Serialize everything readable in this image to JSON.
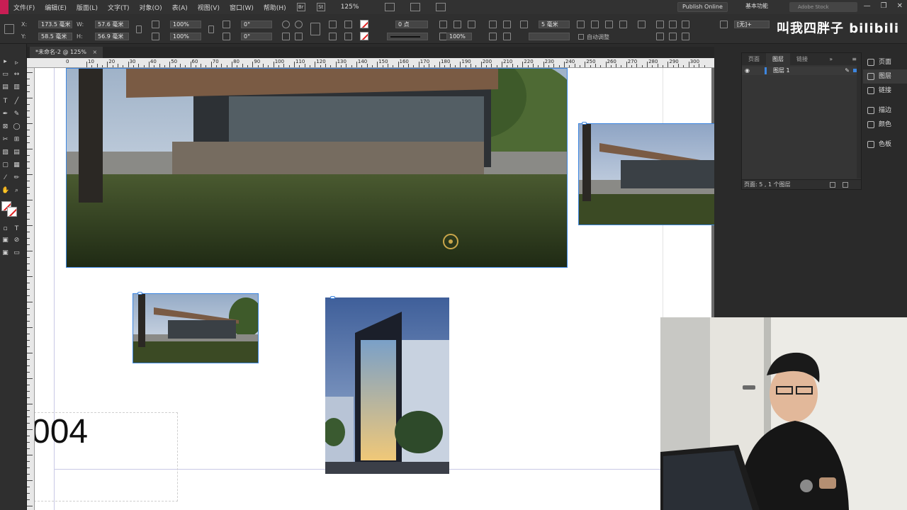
{
  "menu": {
    "items": [
      "文件(F)",
      "编辑(E)",
      "版面(L)",
      "文字(T)",
      "对象(O)",
      "表(A)",
      "视图(V)",
      "窗口(W)",
      "帮助(H)"
    ],
    "icon_br": "Br",
    "icon_st": "St",
    "zoom": "125%",
    "publish": "Publish Online",
    "workspace": "基本功能",
    "stock_placeholder": "Adobe Stock",
    "win_min": "—",
    "win_max": "❐",
    "win_close": "✕"
  },
  "control": {
    "x_label": "X:",
    "x": "173.5 毫米",
    "y_label": "Y:",
    "y": "58.5 毫米",
    "w_label": "W:",
    "w": "57.6 毫米",
    "h_label": "H:",
    "h": "56.9 毫米",
    "scale_x": "100%",
    "scale_y": "100%",
    "rotate": "0°",
    "shear": "0°",
    "stroke_weight": "0 点",
    "gap": "5 毫米",
    "opacity": "100%",
    "auto_fit": "自动调整",
    "style": "[无]+",
    "watermark": "叫我四胖子 bilibili"
  },
  "tab": {
    "title": "*未命名-2 @ 125%",
    "close": "×"
  },
  "ruler": {
    "labels": [
      "10",
      "20",
      "30",
      "40",
      "50",
      "60",
      "70",
      "80",
      "90",
      "100",
      "110",
      "120",
      "130",
      "140",
      "150",
      "160",
      "170",
      "180",
      "190",
      "200",
      "210",
      "220",
      "230",
      "240",
      "250",
      "260",
      "270",
      "280",
      "290",
      "300"
    ],
    "zero": "0"
  },
  "canvas": {
    "page_number": "004"
  },
  "panel": {
    "tabs": [
      "页面",
      "图层",
      "链接"
    ],
    "more": "»",
    "menu": "≡",
    "layer_name": "图层 1",
    "footer": "页面: 5 , 1 个图层",
    "side_tabs": [
      "页面",
      "图层",
      "链接",
      "描边",
      "颜色",
      "色板"
    ]
  },
  "colors": {
    "accent": "#3d86e0",
    "brand": "#c81e54",
    "panel_bg": "#2a2a2a",
    "canvas_bg": "#ffffff"
  },
  "icons": {
    "selection": "selection-tool-icon",
    "direct": "direct-selection-tool-icon",
    "type": "type-tool-icon",
    "pen": "pen-tool-icon",
    "rectangle": "rectangle-frame-tool-icon",
    "hand": "hand-tool-icon",
    "zoom": "zoom-tool-icon"
  }
}
